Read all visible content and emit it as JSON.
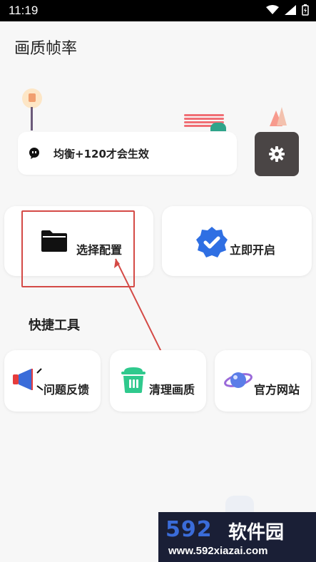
{
  "status_bar": {
    "time": "11:19"
  },
  "app_title": "画质帧率",
  "notice": {
    "text": "均衡+120才会生效"
  },
  "cards": {
    "select_config": "选择配置",
    "start_now": "立即开启"
  },
  "quick_tools": {
    "title": "快捷工具",
    "items": [
      {
        "label": "问题反馈",
        "icon": "megaphone-icon"
      },
      {
        "label": "清理画质",
        "icon": "trash-icon"
      },
      {
        "label": "官方网站",
        "icon": "planet-icon"
      }
    ]
  },
  "watermark": {
    "brand_num": "592",
    "brand_cn": "软件园",
    "url": "www.592xiazai.com"
  },
  "colors": {
    "accent_blue": "#2f6fe3",
    "clean_green": "#2fc98d",
    "gear_bg": "#4a4545",
    "highlight_red": "#d44a46"
  }
}
